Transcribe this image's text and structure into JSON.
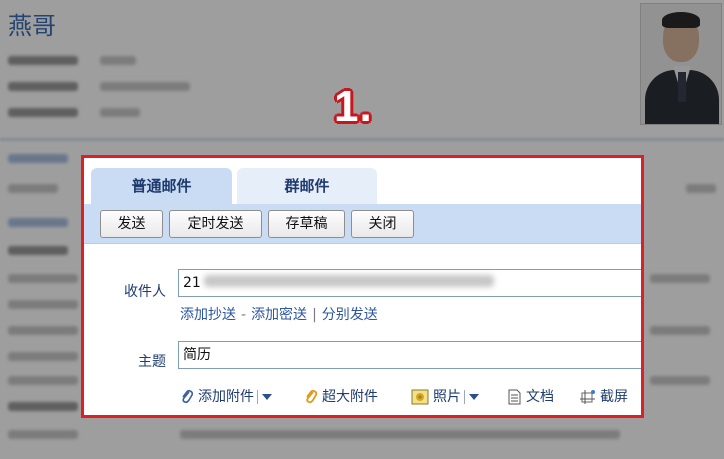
{
  "background": {
    "name": "燕哥"
  },
  "step_label": "1.",
  "compose": {
    "tabs": [
      {
        "label": "普通邮件"
      },
      {
        "label": "群邮件"
      }
    ],
    "toolbar": {
      "send": "发送",
      "scheduled_send": "定时发送",
      "save_draft": "存草稿",
      "close": "关闭"
    },
    "recipient": {
      "label": "收件人",
      "value": "21"
    },
    "recipient_links": {
      "add_cc": "添加抄送",
      "dash": "-",
      "add_bcc": "添加密送",
      "bar": "|",
      "separate_send": "分别发送"
    },
    "subject": {
      "label": "主题",
      "value": "简历"
    },
    "attachments": {
      "add_attachment": "添加附件",
      "large_attachment": "超大附件",
      "photo": "照片",
      "document": "文档",
      "screenshot": "截屏"
    }
  }
}
